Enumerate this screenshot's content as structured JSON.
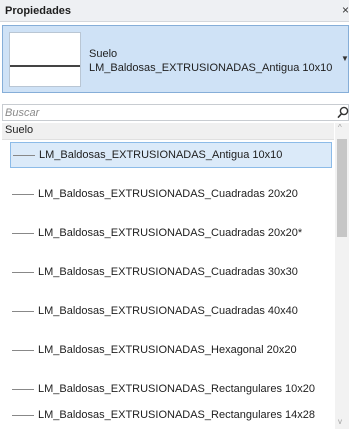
{
  "panel": {
    "title": "Propiedades",
    "close_glyph": "×"
  },
  "type_selector": {
    "family": "Suelo",
    "type_name": "LM_Baldosas_EXTRUSIONADAS_Antigua 10x10",
    "dropdown_glyph": "▼",
    "background_color": "#cfe2f6"
  },
  "search": {
    "placeholder": "Buscar",
    "value": "",
    "icon": "search-icon"
  },
  "group": {
    "label": "Suelo"
  },
  "types": {
    "selected_index": 0,
    "items": [
      {
        "label": "LM_Baldosas_EXTRUSIONADAS_Antigua 10x10"
      },
      {
        "label": "LM_Baldosas_EXTRUSIONADAS_Cuadradas 20x20"
      },
      {
        "label": "LM_Baldosas_EXTRUSIONADAS_Cuadradas 20x20*"
      },
      {
        "label": "LM_Baldosas_EXTRUSIONADAS_Cuadradas 30x30"
      },
      {
        "label": "LM_Baldosas_EXTRUSIONADAS_Cuadradas 40x40"
      },
      {
        "label": "LM_Baldosas_EXTRUSIONADAS_Hexagonal 20x20"
      },
      {
        "label": "LM_Baldosas_EXTRUSIONADAS_Rectangulares 10x20"
      },
      {
        "label": "LM_Baldosas_EXTRUSIONADAS_Rectangulares 14x28"
      }
    ]
  },
  "scrollbar": {
    "up_glyph": "^",
    "down_glyph": "v"
  }
}
